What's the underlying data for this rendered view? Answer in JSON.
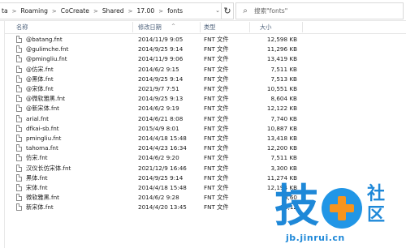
{
  "addressbar": {
    "crumbs": [
      "ta",
      "Roaming",
      "CoCreate",
      "Shared",
      "17.00",
      "fonts"
    ],
    "separator": ">",
    "dropdown_icon": "chevron-down-icon",
    "refresh_icon": "refresh-icon"
  },
  "search": {
    "placeholder": "搜索\"fonts\"",
    "icon": "search-icon"
  },
  "columns": {
    "name": "名称",
    "date": "修改日期",
    "type": "类型",
    "size": "大小"
  },
  "files": [
    {
      "name": "@batang.fnt",
      "date": "2014/11/9 9:05",
      "type": "FNT 文件",
      "size": "12,598 KB"
    },
    {
      "name": "@gulimche.fnt",
      "date": "2014/9/25 9:14",
      "type": "FNT 文件",
      "size": "11,296 KB"
    },
    {
      "name": "@pmingliu.fnt",
      "date": "2014/11/9 9:06",
      "type": "FNT 文件",
      "size": "13,419 KB"
    },
    {
      "name": "@仿宋.fnt",
      "date": "2014/6/2 9:15",
      "type": "FNT 文件",
      "size": "7,511 KB"
    },
    {
      "name": "@黑体.fnt",
      "date": "2014/9/25 9:14",
      "type": "FNT 文件",
      "size": "7,513 KB"
    },
    {
      "name": "@宋体.fnt",
      "date": "2021/9/7 7:51",
      "type": "FNT 文件",
      "size": "10,551 KB"
    },
    {
      "name": "@微软雅黑.fnt",
      "date": "2014/9/25 9:13",
      "type": "FNT 文件",
      "size": "8,604 KB"
    },
    {
      "name": "@新宋体.fnt",
      "date": "2014/6/2 9:19",
      "type": "FNT 文件",
      "size": "12,122 KB"
    },
    {
      "name": "arial.fnt",
      "date": "2014/6/21 8:08",
      "type": "FNT 文件",
      "size": "7,740 KB"
    },
    {
      "name": "dfkai-sb.fnt",
      "date": "2015/4/9 8:01",
      "type": "FNT 文件",
      "size": "10,887 KB"
    },
    {
      "name": "pmingliu.fnt",
      "date": "2014/4/18 15:48",
      "type": "FNT 文件",
      "size": "13,418 KB"
    },
    {
      "name": "tahoma.fnt",
      "date": "2014/4/23 16:34",
      "type": "FNT 文件",
      "size": "12,200 KB"
    },
    {
      "name": "仿宋.fnt",
      "date": "2014/6/2 9:20",
      "type": "FNT 文件",
      "size": "7,511 KB"
    },
    {
      "name": "汉仪长仿宋体.fnt",
      "date": "2021/12/9 16:46",
      "type": "FNT 文件",
      "size": "3,300 KB"
    },
    {
      "name": "黑体.fnt",
      "date": "2014/9/25 9:14",
      "type": "FNT 文件",
      "size": "11,274 KB"
    },
    {
      "name": "宋体.fnt",
      "date": "2014/4/18 15:48",
      "type": "FNT 文件",
      "size": "12,194 KB"
    },
    {
      "name": "微软雅黑.fnt",
      "date": "2014/6/2 9:28",
      "type": "FNT 文件",
      "size": "8,60"
    },
    {
      "name": "新宋体.fnt",
      "date": "2014/4/20 13:45",
      "type": "FNT 文件",
      "size": "12,12"
    }
  ],
  "watermark": {
    "main": "技",
    "side_top": "社",
    "side_bottom": "区",
    "url": "jb.jinrui.cn",
    "colors": {
      "blue": "#1e88d8",
      "orange": "#f7941d"
    }
  },
  "colors": {
    "header_text": "#4c607a",
    "border": "#e5e5e5"
  }
}
